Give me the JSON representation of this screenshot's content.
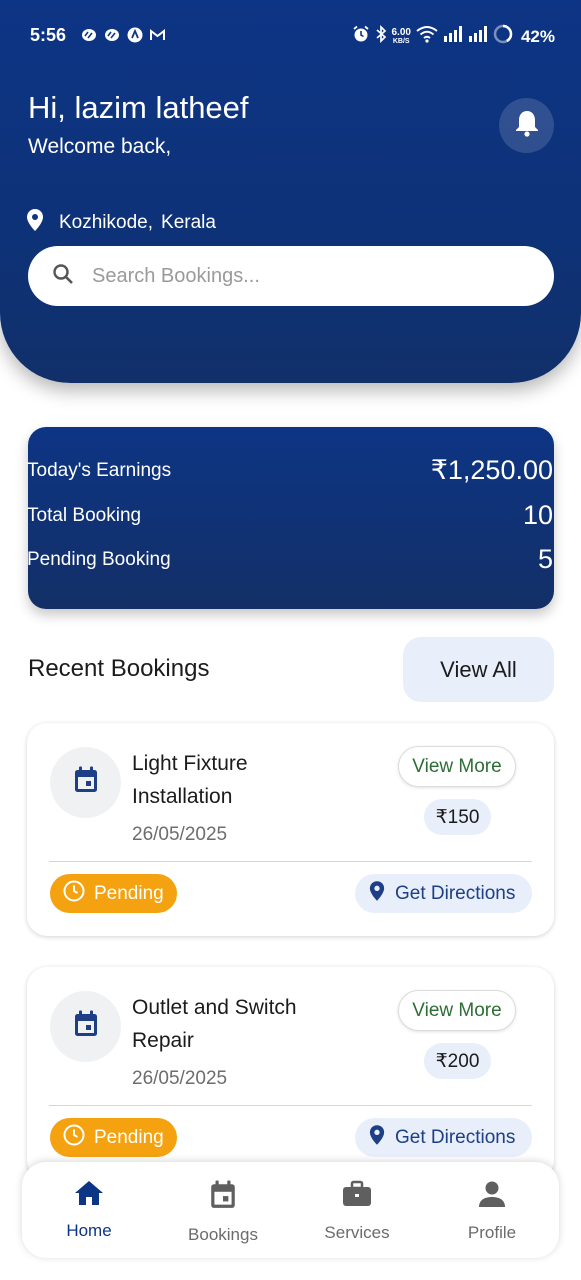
{
  "status_bar": {
    "time": "5:56",
    "net_speed": "6.00",
    "net_unit": "KB/S",
    "battery": "42%"
  },
  "header": {
    "greeting": "Hi, lazim latheef",
    "welcome": "Welcome back,",
    "location_city": "Kozhikode,",
    "location_state": "Kerala"
  },
  "search": {
    "placeholder": "Search Bookings..."
  },
  "stats": {
    "earnings_label": "Today's Earnings",
    "earnings_value": "₹1,250.00",
    "total_label": "Total Booking",
    "total_value": "10",
    "pending_label": "Pending Booking",
    "pending_value": "5"
  },
  "recent": {
    "title": "Recent Bookings",
    "view_all": "View All"
  },
  "bookings": [
    {
      "title": "Light Fixture Installation",
      "date": "26/05/2025",
      "view_more": "View More",
      "price": "₹150",
      "status": "Pending",
      "directions": "Get Directions"
    },
    {
      "title": "Outlet and Switch Repair",
      "date": "26/05/2025",
      "view_more": "View More",
      "price": "₹200",
      "status": "Pending",
      "directions": "Get Directions"
    }
  ],
  "nav": {
    "items": [
      {
        "label": "Home",
        "icon": "home-icon",
        "active": true
      },
      {
        "label": "Bookings",
        "icon": "calendar-icon",
        "active": false
      },
      {
        "label": "Services",
        "icon": "briefcase-icon",
        "active": false
      },
      {
        "label": "Profile",
        "icon": "person-icon",
        "active": false
      }
    ]
  },
  "colors": {
    "primary": "#0d3585",
    "pending": "#f4a20f",
    "chip_bg": "#e9eefb",
    "view_more_text": "#2d6e35"
  }
}
